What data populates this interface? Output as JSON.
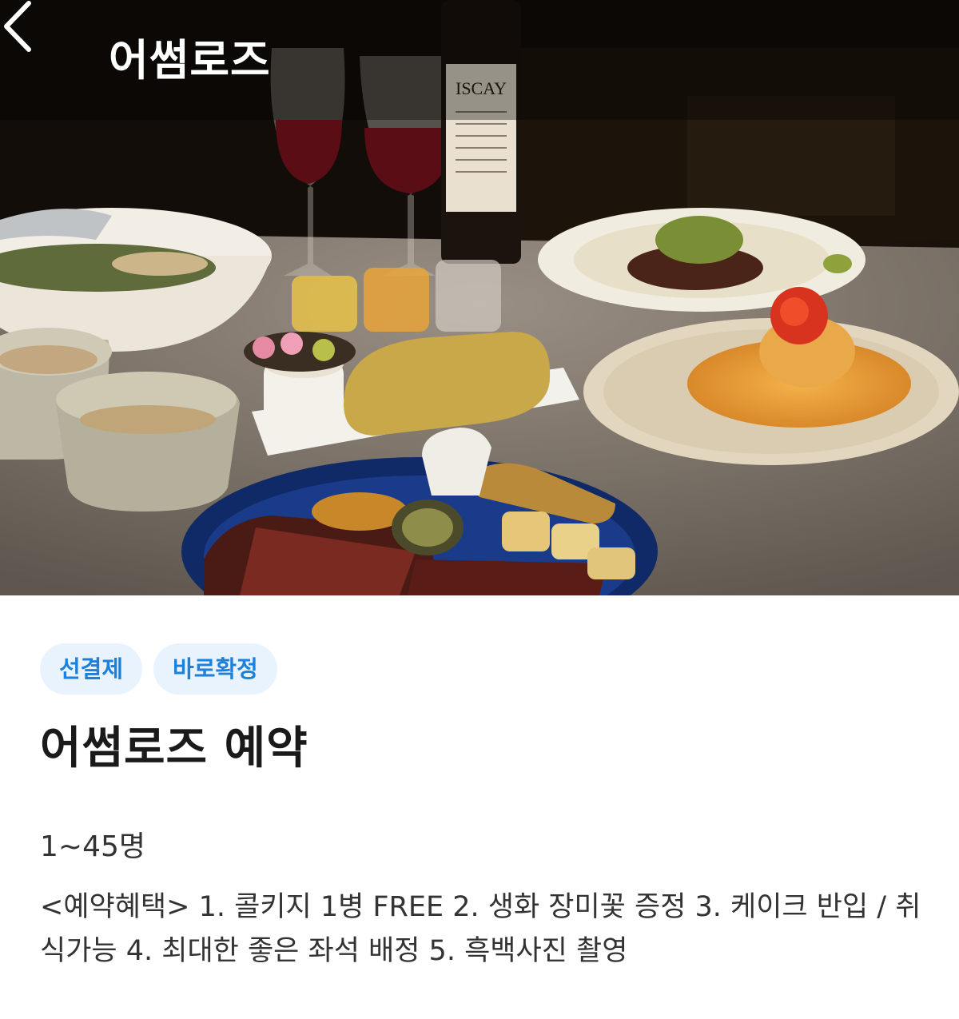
{
  "header": {
    "title": "어썸로즈",
    "back_icon": "chevron-left-icon"
  },
  "hero_image": {
    "wine_label": "ISCAY"
  },
  "badges": [
    "선결제",
    "바로확정"
  ],
  "colors": {
    "badge_bg": "#e9f3fd",
    "badge_text": "#1e80d8",
    "title_text": "#1a1a1a"
  },
  "listing": {
    "title": "어썸로즈 예약",
    "capacity": "1~45명",
    "benefits": "<예약혜택> 1. 콜키지 1병 FREE 2. 생화 장미꽃 증정 3. 케이크 반입 / 취식가능 4. 최대한 좋은 좌석 배정 5. 흑백사진 촬영"
  }
}
